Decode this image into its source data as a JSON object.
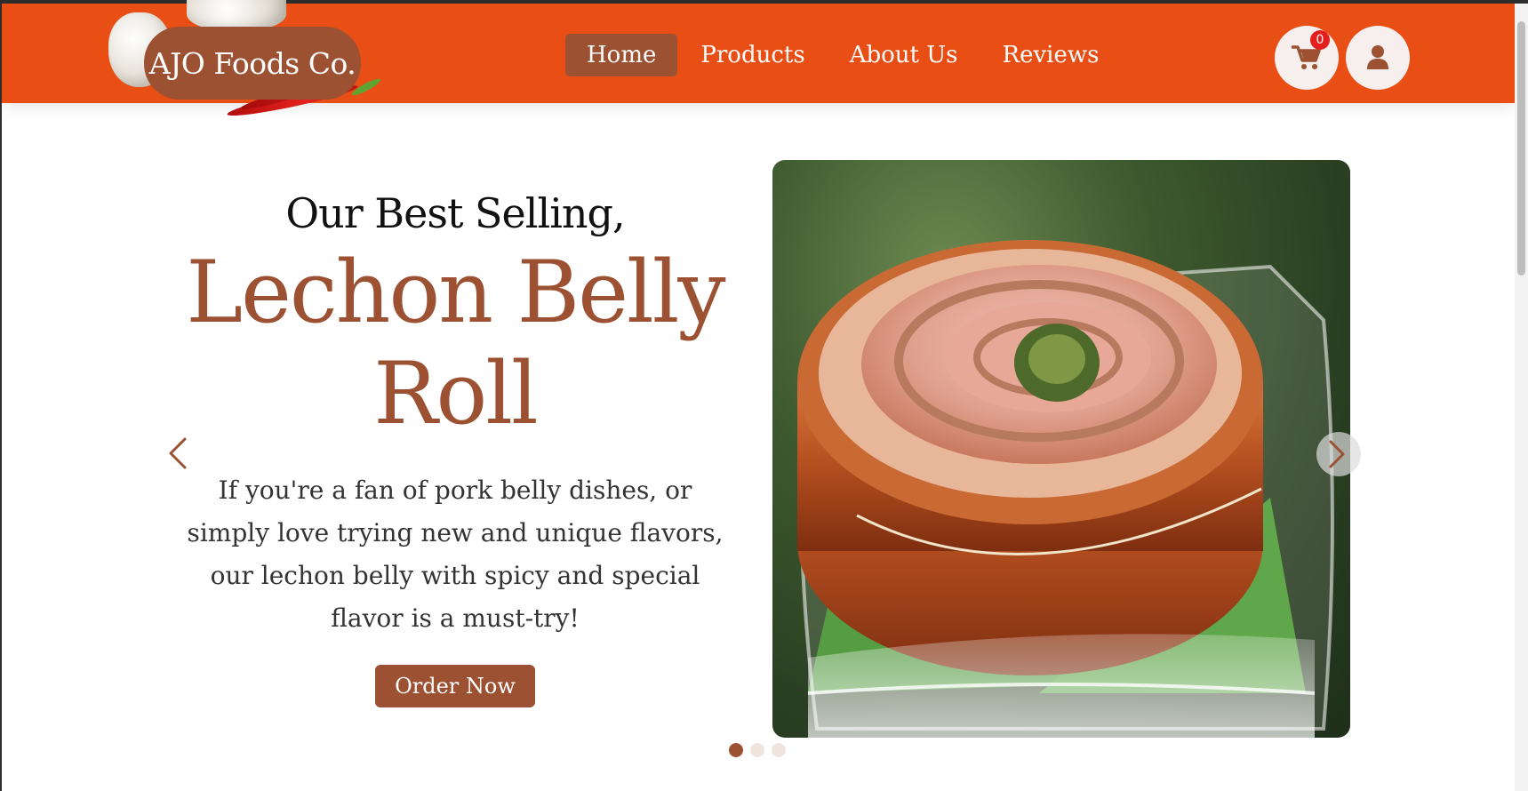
{
  "brand": {
    "name": "AJO Foods Co."
  },
  "nav": {
    "items": [
      {
        "label": "Home",
        "active": true
      },
      {
        "label": "Products",
        "active": false
      },
      {
        "label": "About Us",
        "active": false
      },
      {
        "label": "Reviews",
        "active": false
      }
    ]
  },
  "header": {
    "cart_count": "0",
    "cart_icon": "shopping-cart-icon",
    "user_icon": "user-icon"
  },
  "hero": {
    "kicker": "Our Best Selling,",
    "title_line1": "Lechon Belly",
    "title_line2": "Roll",
    "description": "If you're a fan of pork belly dishes, or simply love trying new and unique flavors, our lechon belly with spicy and special flavor is a must-try!",
    "cta_label": "Order Now"
  },
  "carousel": {
    "active_index": 0,
    "slide_count": 3,
    "prev_icon": "chevron-left-icon",
    "next_icon": "chevron-right-icon"
  },
  "colors": {
    "navbar": "#e94e14",
    "accent": "#9c5132",
    "badge": "#e41d1d"
  }
}
